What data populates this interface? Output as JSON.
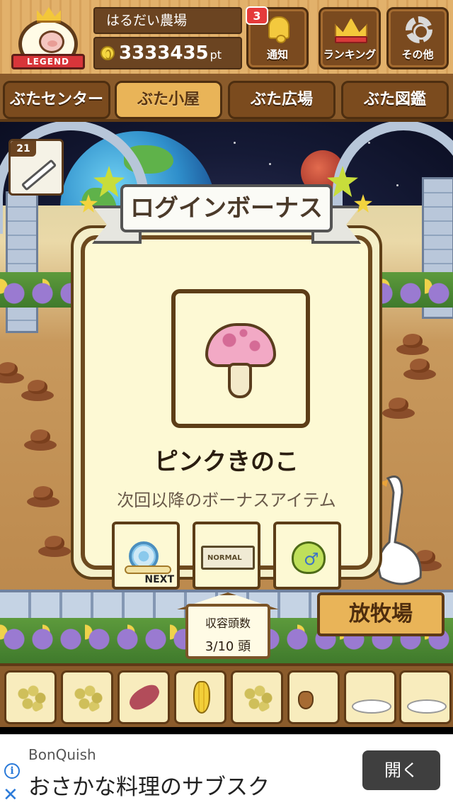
{
  "header": {
    "badge_label": "LEGEND",
    "farm_name": "はるだい農場",
    "points": "3333435",
    "points_unit": "pt",
    "notification": {
      "label": "通知",
      "count": "3"
    },
    "ranking_label": "ランキング",
    "settings_label": "その他"
  },
  "tabs": [
    {
      "label": "ぶたセンター",
      "active": false
    },
    {
      "label": "ぶた小屋",
      "active": true
    },
    {
      "label": "ぶた広場",
      "active": false
    },
    {
      "label": "ぶた図鑑",
      "active": false
    }
  ],
  "syringe": {
    "count": "21",
    "icon": "syringe-icon"
  },
  "modal": {
    "title": "ログインボーナス",
    "item_name": "ピンクきのこ",
    "item_icon": "pink-mushroom-icon",
    "next_caption": "次回以降のボーナスアイテム",
    "upcoming": [
      {
        "icon": "snail-icon",
        "caption": "NEXT"
      },
      {
        "icon": "ticket-icon",
        "caption": "NORMAL"
      },
      {
        "icon": "male-apple-icon",
        "caption": ""
      }
    ]
  },
  "capacity": {
    "label": "収容頭数",
    "value": "3/10 頭"
  },
  "pasture_sign": "放牧場",
  "feeds": [
    {
      "icon": "soybeans-icon"
    },
    {
      "icon": "grains-icon"
    },
    {
      "icon": "sweet-potato-icon"
    },
    {
      "icon": "corn-icon"
    },
    {
      "icon": "mixed-feed-icon"
    },
    {
      "icon": "acorn-icon"
    },
    {
      "icon": "rice-plate-icon"
    },
    {
      "icon": "meatball-plate-icon"
    }
  ],
  "ad": {
    "brand": "BonQuish",
    "title": "おさかな料理のサブスク",
    "button": "開く"
  },
  "colors": {
    "wood": "#8a5b2b",
    "active_tab": "#e9b458",
    "modal_bg": "#fdf9d4",
    "notif_red": "#e53b3b"
  }
}
